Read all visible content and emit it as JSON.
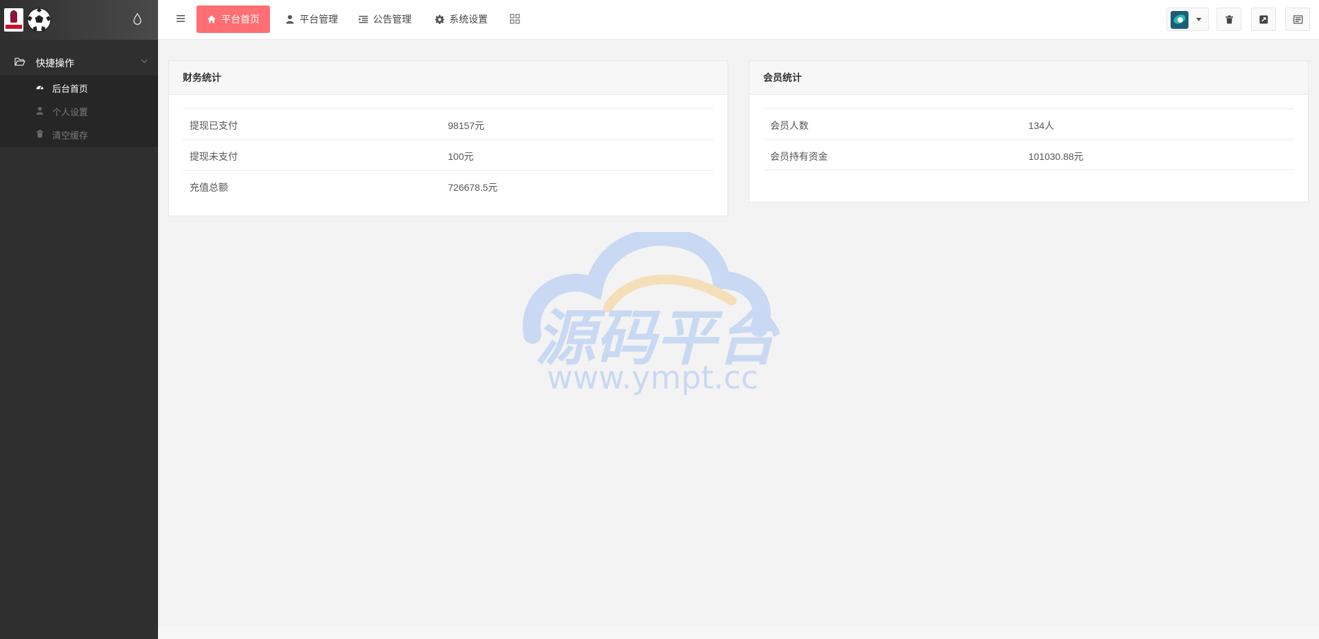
{
  "topbar": {
    "tabs": [
      {
        "label": "平台首页",
        "icon": "home-icon",
        "active": true
      },
      {
        "label": "平台管理",
        "icon": "user-icon",
        "active": false
      },
      {
        "label": "公告管理",
        "icon": "list-indent-icon",
        "active": false
      },
      {
        "label": "系统设置",
        "icon": "gear-icon",
        "active": false
      }
    ]
  },
  "sidebar": {
    "group_label": "快捷操作",
    "items": [
      {
        "label": "后台首页",
        "icon": "dashboard-icon",
        "active": true
      },
      {
        "label": "个人设置",
        "icon": "user-icon",
        "active": false
      },
      {
        "label": "清空缓存",
        "icon": "trash-icon",
        "active": false
      }
    ]
  },
  "finance": {
    "title": "财务统计",
    "rows": [
      {
        "key": "提现已支付",
        "value": "98157元"
      },
      {
        "key": "提现未支付",
        "value": "100元"
      },
      {
        "key": "充值总额",
        "value": "726678.5元"
      }
    ]
  },
  "member": {
    "title": "会员统计",
    "rows": [
      {
        "key": "会员人数",
        "value": "134人"
      },
      {
        "key": "会员持有资金",
        "value": "101030.88元"
      }
    ]
  },
  "watermark": {
    "brand": "源码平台",
    "url": "www.ympt.cc"
  },
  "colors": {
    "sidebar_bg": "#2f2f2f",
    "active_tab": "#ff6e73",
    "content_bg": "#f3f3f3"
  }
}
